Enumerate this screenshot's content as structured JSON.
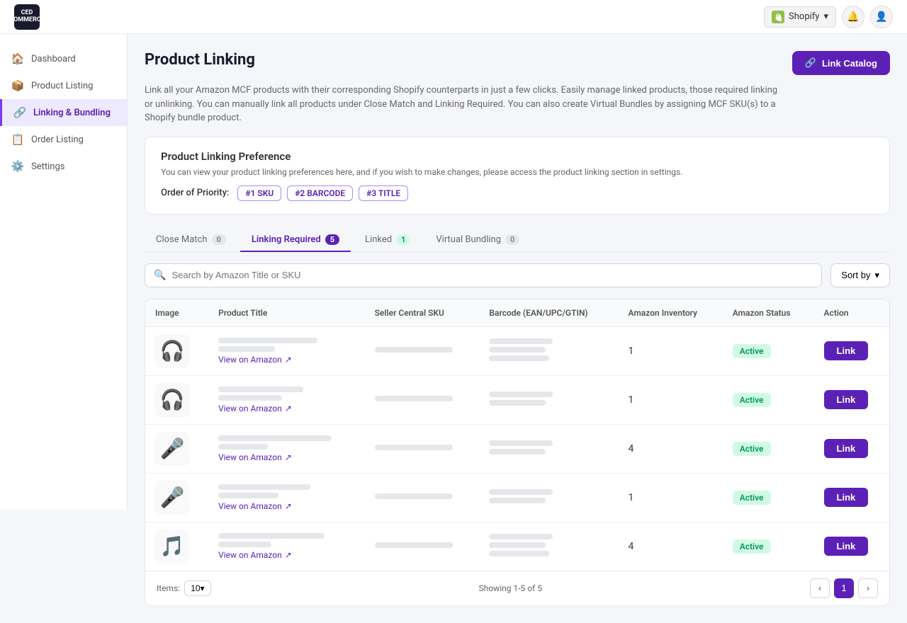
{
  "topbar": {
    "shopify_label": "Shopify",
    "chevron": "▾"
  },
  "logo": {
    "line1": "CED",
    "line2": "COMMERCE"
  },
  "sidebar": {
    "items": [
      {
        "id": "dashboard",
        "label": "Dashboard",
        "icon": "🏠",
        "active": false
      },
      {
        "id": "product-listing",
        "label": "Product Listing",
        "icon": "📦",
        "active": false
      },
      {
        "id": "linking-bundling",
        "label": "Linking & Bundling",
        "icon": "🔗",
        "active": true
      },
      {
        "id": "order-listing",
        "label": "Order Listing",
        "icon": "📋",
        "active": false
      },
      {
        "id": "settings",
        "label": "Settings",
        "icon": "⚙️",
        "active": false
      }
    ]
  },
  "page": {
    "title": "Product Linking",
    "description": "Link all your Amazon MCF products with their corresponding Shopify counterparts in just a few clicks. Easily manage linked products, those required linking or unlinking. You can manually link all products under Close Match and Linking Required. You can also create Virtual Bundles by assigning MCF SKU(s) to a Shopify bundle product.",
    "link_catalog_btn": "Link Catalog",
    "link_icon": "🔗"
  },
  "preference": {
    "title": "Product Linking Preference",
    "description": "You can view your product linking preferences here, and if you wish to make changes, please access the product linking section in settings.",
    "priority_label": "Order of Priority:",
    "badges": [
      "#1 SKU",
      "#2 BARCODE",
      "#3 TITLE"
    ]
  },
  "tabs": [
    {
      "id": "close-match",
      "label": "Close Match",
      "count": "0",
      "badge_type": "zero",
      "active": false
    },
    {
      "id": "linking-required",
      "label": "Linking Required",
      "count": "5",
      "badge_type": "purple",
      "active": true
    },
    {
      "id": "linked",
      "label": "Linked",
      "count": "1",
      "badge_type": "gray",
      "active": false
    },
    {
      "id": "virtual-bundling",
      "label": "Virtual Bundling",
      "count": "0",
      "badge_type": "zero",
      "active": false
    }
  ],
  "toolbar": {
    "search_placeholder": "Search by Amazon Title or SKU",
    "sort_label": "Sort by"
  },
  "table": {
    "columns": [
      "Image",
      "Product Title",
      "Seller Central SKU",
      "Barcode (EAN/UPC/GTIN)",
      "Amazon Inventory",
      "Amazon Status",
      "Action"
    ],
    "rows": [
      {
        "id": 1,
        "emoji": "🎧",
        "inventory": "1",
        "status": "Active",
        "link_label": "Link",
        "view_label": "View on Amazon"
      },
      {
        "id": 2,
        "emoji": "🎧",
        "inventory": "1",
        "status": "Active",
        "link_label": "Link",
        "view_label": "View on Amazon"
      },
      {
        "id": 3,
        "emoji": "🎤",
        "inventory": "4",
        "status": "Active",
        "link_label": "Link",
        "view_label": "View on Amazon"
      },
      {
        "id": 4,
        "emoji": "🎤",
        "inventory": "1",
        "status": "Active",
        "link_label": "Link",
        "view_label": "View on Amazon"
      },
      {
        "id": 5,
        "emoji": "🎵",
        "inventory": "4",
        "status": "Active",
        "link_label": "Link",
        "view_label": "View on Amazon"
      }
    ]
  },
  "footer": {
    "items_label": "Items:",
    "items_value": "10▾",
    "showing_label": "Showing 1-5 of 5",
    "prev_icon": "‹",
    "next_icon": "›",
    "page": "1"
  }
}
